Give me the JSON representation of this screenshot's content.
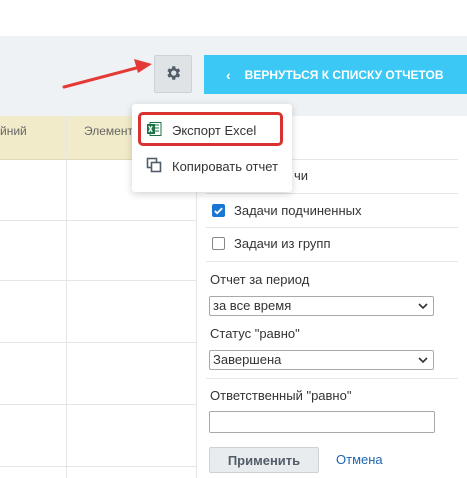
{
  "toolbar": {
    "gear_icon": "gear-icon",
    "back_button": "ВЕРНУТЬСЯ К СПИСКУ ОТЧЕТОВ",
    "back_chevron": "‹"
  },
  "table": {
    "headers": [
      "йний",
      "Элемент CRM"
    ]
  },
  "menu": {
    "items": [
      {
        "label": "Экспорт Excel",
        "icon": "excel-icon"
      },
      {
        "label": "Копировать отчет",
        "icon": "copy-icon"
      }
    ]
  },
  "filters": {
    "checkbox_partial": "чи",
    "checkboxes": [
      {
        "label": "Задачи подчиненных",
        "checked": true
      },
      {
        "label": "Задачи из групп",
        "checked": false
      }
    ],
    "period_label": "Отчет за период",
    "period_value": "за все время",
    "status_label": "Статус \"равно\"",
    "status_value": "Завершена",
    "responsible_label": "Ответственный \"равно\"",
    "responsible_value": "",
    "apply_label": "Применить",
    "cancel_label": "Отмена"
  },
  "colors": {
    "accent_button": "#3bc8f5",
    "highlight_border": "#d9312f",
    "arrow": "#e53935",
    "table_header": "#f1ebc9",
    "excel_green": "#1e7145"
  }
}
